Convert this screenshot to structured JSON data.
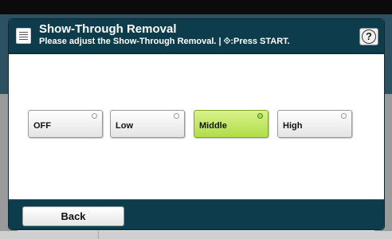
{
  "dialog": {
    "title": "Show-Through Removal",
    "subtitle": "Please adjust the Show-Through Removal. | ⟐:Press START.",
    "help_label": "?"
  },
  "options": [
    {
      "label": "OFF",
      "selected": false
    },
    {
      "label": "Low",
      "selected": false
    },
    {
      "label": "Middle",
      "selected": true
    },
    {
      "label": "High",
      "selected": false
    }
  ],
  "footer": {
    "back_label": "Back"
  },
  "colors": {
    "title_bar": "#0d3d4c",
    "selected_option": "#b2dd4a",
    "option_default": "#e4e4e4"
  },
  "icons": [
    "document-icon",
    "help-icon",
    "status-dot-icon"
  ]
}
